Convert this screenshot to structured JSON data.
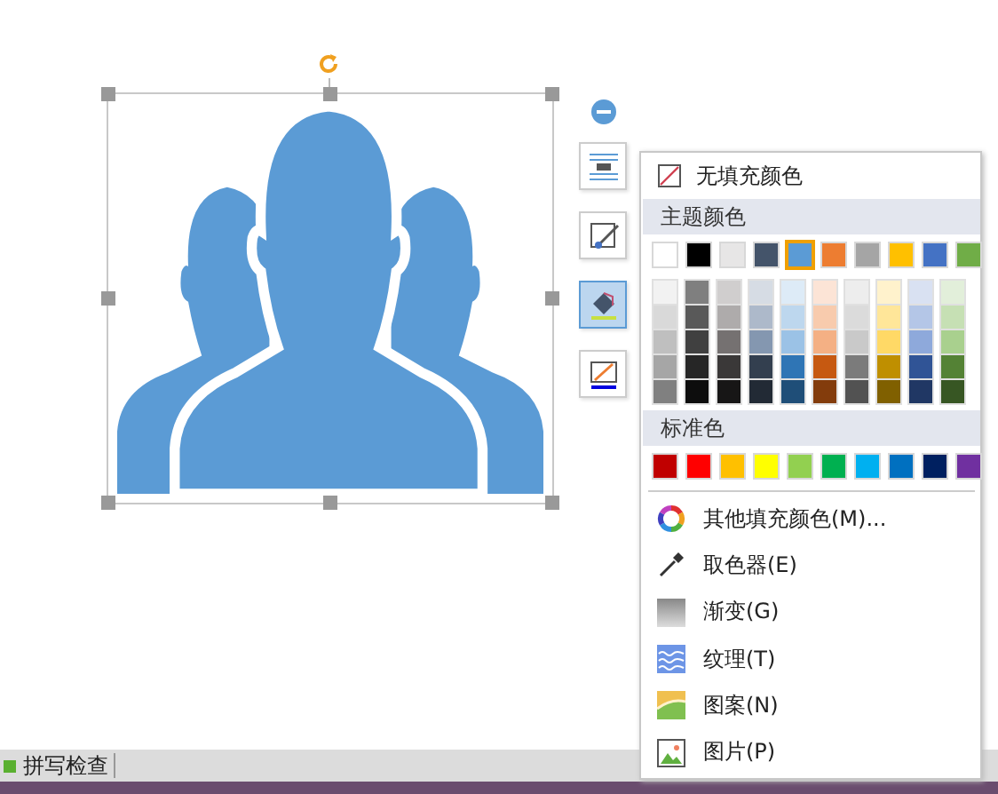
{
  "toolbar": [
    {
      "kind": "collapse",
      "selected": false
    },
    {
      "kind": "layout",
      "selected": false
    },
    {
      "kind": "outline",
      "selected": false
    },
    {
      "kind": "fill",
      "selected": true
    },
    {
      "kind": "line",
      "selected": false
    }
  ],
  "menu": {
    "no_fill": "无填充颜色",
    "theme_title": "主题颜色",
    "theme_colors": [
      {
        "color": "#ffffff",
        "selected": false
      },
      {
        "color": "#000000",
        "selected": false
      },
      {
        "color": "#e7e6e6",
        "selected": false
      },
      {
        "color": "#44546a",
        "selected": false
      },
      {
        "color": "#5b9bd5",
        "selected": true
      },
      {
        "color": "#ed7d31",
        "selected": false
      },
      {
        "color": "#a5a5a5",
        "selected": false
      },
      {
        "color": "#ffc000",
        "selected": false
      },
      {
        "color": "#4472c4",
        "selected": false
      },
      {
        "color": "#70ad47",
        "selected": false
      }
    ],
    "shades": [
      [
        {
          "color": "#f2f2f2"
        },
        {
          "color": "#7f7f7f"
        },
        {
          "color": "#d0cece"
        },
        {
          "color": "#d6dce4"
        },
        {
          "color": "#ddebf7"
        },
        {
          "color": "#fce4d6"
        },
        {
          "color": "#ededed"
        },
        {
          "color": "#fff2cc"
        },
        {
          "color": "#d9e1f2"
        },
        {
          "color": "#e2efda"
        }
      ],
      [
        {
          "color": "#d9d9d9"
        },
        {
          "color": "#595959"
        },
        {
          "color": "#aeabab"
        },
        {
          "color": "#adb9ca"
        },
        {
          "color": "#bdd7ee"
        },
        {
          "color": "#f8cbad"
        },
        {
          "color": "#dbdbdb"
        },
        {
          "color": "#ffe699"
        },
        {
          "color": "#b4c6e7"
        },
        {
          "color": "#c6e0b4"
        }
      ],
      [
        {
          "color": "#bfbfbf"
        },
        {
          "color": "#404040"
        },
        {
          "color": "#757171"
        },
        {
          "color": "#8497b0"
        },
        {
          "color": "#9bc2e6"
        },
        {
          "color": "#f4b084"
        },
        {
          "color": "#c9c9c9"
        },
        {
          "color": "#ffd966"
        },
        {
          "color": "#8ea9db"
        },
        {
          "color": "#a9d08e"
        }
      ],
      [
        {
          "color": "#a6a6a6"
        },
        {
          "color": "#262626"
        },
        {
          "color": "#3a3838"
        },
        {
          "color": "#333f4f"
        },
        {
          "color": "#2f75b5"
        },
        {
          "color": "#c65911"
        },
        {
          "color": "#7b7b7b"
        },
        {
          "color": "#bf8f00"
        },
        {
          "color": "#305496"
        },
        {
          "color": "#548235"
        }
      ],
      [
        {
          "color": "#808080"
        },
        {
          "color": "#0d0d0d"
        },
        {
          "color": "#171616"
        },
        {
          "color": "#222a35"
        },
        {
          "color": "#1f4e78"
        },
        {
          "color": "#833c0c"
        },
        {
          "color": "#525252"
        },
        {
          "color": "#806000"
        },
        {
          "color": "#203764"
        },
        {
          "color": "#375623"
        }
      ]
    ],
    "standard_title": "标准色",
    "standard_colors": [
      {
        "color": "#c00000"
      },
      {
        "color": "#ff0000"
      },
      {
        "color": "#ffc000"
      },
      {
        "color": "#ffff00"
      },
      {
        "color": "#92d050"
      },
      {
        "color": "#00b050"
      },
      {
        "color": "#00b0f0"
      },
      {
        "color": "#0070c0"
      },
      {
        "color": "#002060"
      },
      {
        "color": "#7030a0"
      }
    ],
    "items": [
      {
        "kind": "palette",
        "label": "其他填充颜色(M)..."
      },
      {
        "kind": "picker",
        "label": "取色器(E)"
      },
      {
        "kind": "gradient",
        "label": "渐变(G)"
      },
      {
        "kind": "texture",
        "label": "纹理(T)"
      },
      {
        "kind": "pattern",
        "label": "图案(N)"
      },
      {
        "kind": "image",
        "label": "图片(P)"
      }
    ]
  },
  "status_bar": {
    "spell_check": "拼写检查"
  }
}
